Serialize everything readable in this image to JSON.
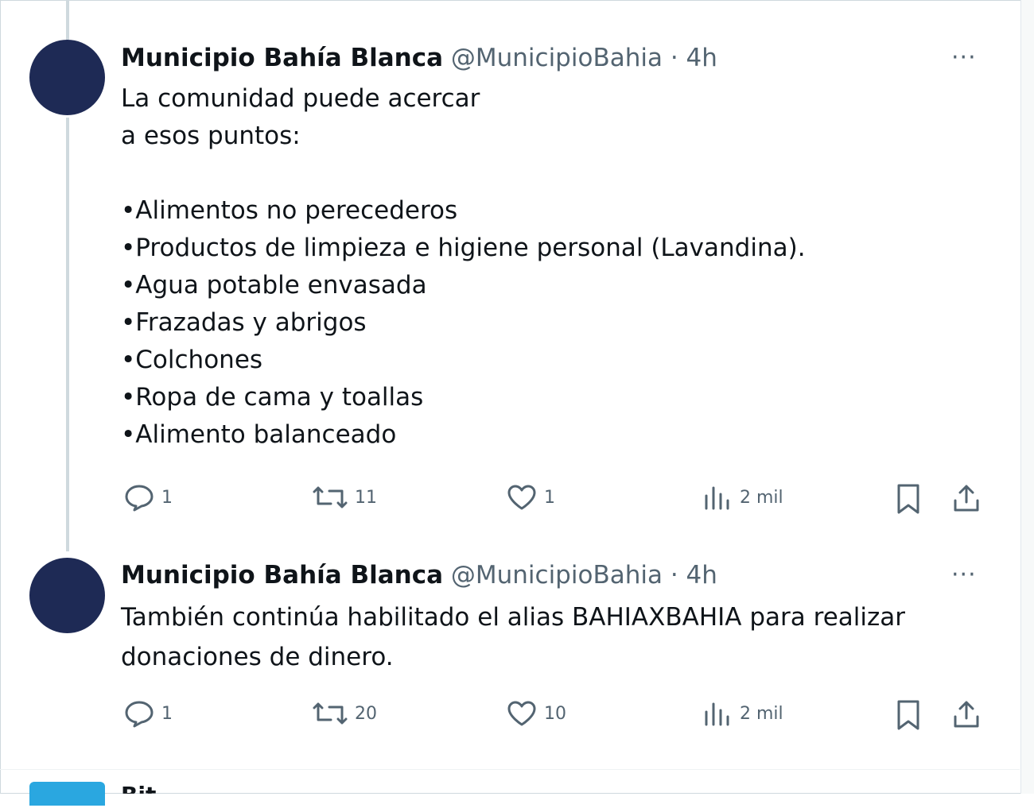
{
  "tweets": [
    {
      "author_name": "Municipio Bahía Blanca",
      "meta": "@MunicipioBahia · 4h",
      "avatar_text": "",
      "body": "La comunidad puede acercar\na esos puntos:\n\n•Alimentos no perecederos\n•Productos de limpieza e higiene personal (Lavandina).\n•Agua potable envasada\n•Frazadas y abrigos\n•Colchones\n•Ropa de cama y toallas\n•Alimento balanceado",
      "more_icon": "more-horizontal-icon",
      "replies": "1",
      "retweets": "11",
      "likes": "1",
      "views": "2 mil"
    },
    {
      "author_name": "Municipio Bahía Blanca",
      "meta": "@MunicipioBahia · 4h",
      "avatar_text": "",
      "body": "También continúa habilitado el alias BAHIAXBAHIA para realizar\ndonaciones de dinero.",
      "more_icon": "more-horizontal-icon",
      "replies": "1",
      "retweets": "20",
      "likes": "10",
      "views": "2 mil"
    }
  ],
  "next_tweet": {
    "author_name_partial": "Bit..."
  },
  "colors": {
    "text": "#0f1419",
    "muted": "#536471",
    "avatar": "#1e2a55",
    "border": "#cfd9de"
  }
}
